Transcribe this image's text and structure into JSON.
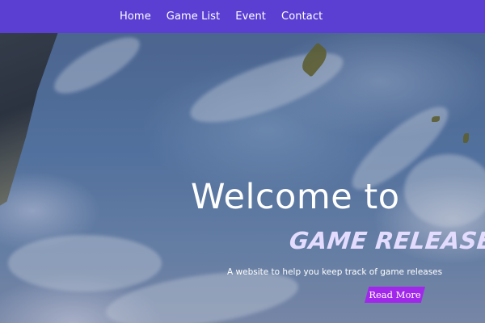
{
  "nav": {
    "items": [
      {
        "label": "Home"
      },
      {
        "label": "Game List"
      },
      {
        "label": "Event"
      },
      {
        "label": "Contact"
      }
    ],
    "background_color": "#5b3fd3"
  },
  "hero": {
    "headline": "Welcome to",
    "brand": "GAME RELEASE",
    "tagline": "A website to help you keep track of game releases",
    "cta_label": "Read More",
    "cta_color": "#a128ea",
    "brand_color": "#e3dcff"
  }
}
